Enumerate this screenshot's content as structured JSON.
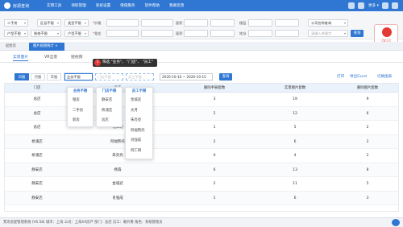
{
  "app": {
    "brand": "房源查询"
  },
  "nav": [
    "实用工具",
    "领取管理",
    "系统设置",
    "增值服务",
    "软件帮助",
    "我要反馈"
  ],
  "topbar_right": {
    "more": "更多 ▾"
  },
  "filters": {
    "row1": [
      {
        "label": "",
        "value": "二手房"
      },
      {
        "label": "",
        "value": "区县不限"
      },
      {
        "label": "",
        "value": "类型不限"
      },
      {
        "label": "",
        "value": "户型不限"
      }
    ],
    "row1_fields": {
      "price_label": "价格",
      "area_label": "面积",
      "floor_label": "楼层",
      "company_value": "公司名称查询"
    },
    "row2": [
      {
        "value": "户型不限"
      },
      {
        "value": "装修不限"
      },
      {
        "value": "楼层不限"
      },
      {
        "value": "朝向不限"
      }
    ],
    "row2_fields": {
      "rent_label": "租金",
      "size_label": "面积",
      "address_label": "地址",
      "keyword_placeholder": "请输入关键字",
      "query_button": "查询"
    },
    "badge_text": "[学习]"
  },
  "page_tabs": {
    "home": "起始页",
    "stats": "图片视频统计"
  },
  "sub_tabs": [
    "实景图片",
    "VR全景",
    "短视频"
  ],
  "tooltip": {
    "num": "1",
    "text": "筛选 \"业务\"、 \"门店\"、 \"员工\""
  },
  "toolbar": {
    "periods": [
      "日报",
      "月报",
      "年报"
    ],
    "business_select": "业务不限",
    "store_select": "门店不限",
    "staff_select": "员工不限",
    "date_range": "2020-10-10 ~ 2020-10-15",
    "query": "查询",
    "print": "打印",
    "export": "导出Excel",
    "switch": "切换图表"
  },
  "table": {
    "headers": [
      "门店",
      "员工",
      "删除手册套数",
      "实景图片套数",
      "删除图片套数"
    ],
    "rows": [
      [
        "总店",
        "何立",
        "3",
        "19",
        "9"
      ],
      [
        "总店",
        "文月",
        "2",
        "12",
        "6"
      ],
      [
        "总店",
        "何仁明",
        "1",
        "5",
        "2"
      ],
      [
        "桥浦店",
        "阿福熊托",
        "2",
        "6",
        "2"
      ],
      [
        "桥浦店",
        "朱亮亮",
        "0",
        "4",
        "2"
      ],
      [
        "静安店",
        "杨森",
        "6",
        "13",
        "8"
      ],
      [
        "静安店",
        "金城武",
        "2",
        "11",
        "5"
      ],
      [
        "静安店",
        "肖强成",
        "1",
        "6",
        "3"
      ]
    ]
  },
  "dropdowns": {
    "business": {
      "items": [
        "业务不限",
        "租房",
        "二手房",
        "新房"
      ]
    },
    "store": {
      "items": [
        "门店不限",
        "静安店",
        "桥浦店",
        "总店"
      ]
    },
    "staff": {
      "items": [
        "员工不限",
        "金城武",
        "文月",
        "朱亮亮",
        "阿福熊托",
        "肖强成",
        "何仁明"
      ]
    }
  },
  "status": {
    "text": "梵讯房屋管理系统 (V6.58)   城市：上海  公司：上海XX房产  部门：总店  员工：赖开勇  角色：系统管理员"
  }
}
